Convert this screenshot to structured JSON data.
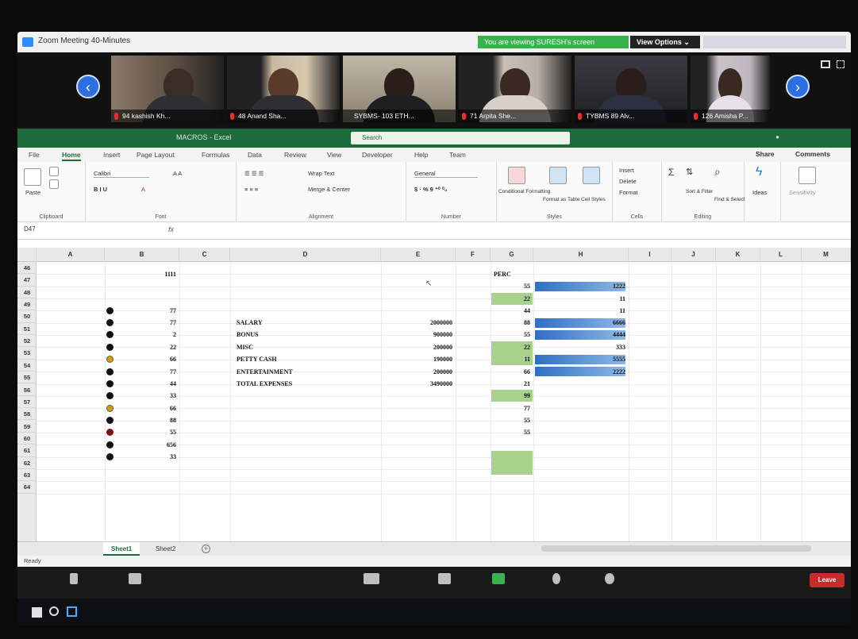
{
  "zoom": {
    "title": "Zoom Meeting 40-Minutes",
    "viewing_banner": "You are viewing SURESH's screen",
    "view_options": "View Options ⌄",
    "participants": [
      {
        "name": "94 kashish Kh..."
      },
      {
        "name": "48 Anand Sha..."
      },
      {
        "name": "SYBMS- 103 ETH..."
      },
      {
        "name": "71 Arpita She..."
      },
      {
        "name": "TYBMS 89 Alv..."
      },
      {
        "name": "126 Amisha P..."
      }
    ],
    "leave_label": "Leave"
  },
  "excel": {
    "title": "MACROS - Excel",
    "search_placeholder": "Search",
    "tabs": [
      "File",
      "Home",
      "Insert",
      "Page Layout",
      "Formulas",
      "Data",
      "Review",
      "View",
      "Developer",
      "Help",
      "Team"
    ],
    "share": "Share",
    "comments": "Comments",
    "ribbon": {
      "paste": "Paste",
      "clipboard": "Clipboard",
      "font_name": "Calibri",
      "font": "Font",
      "wrap_text": "Wrap Text",
      "merge_center": "Merge & Center",
      "alignment": "Alignment",
      "number_format": "General",
      "number": "Number",
      "conditional": "Conditional Formatting",
      "format_table": "Format as Table",
      "cell_styles": "Cell Styles",
      "styles": "Styles",
      "insert": "Insert",
      "delete": "Delete",
      "format": "Format",
      "cells": "Cells",
      "sort_filter": "Sort & Filter",
      "find_select": "Find & Select",
      "editing": "Editing",
      "ideas": "Ideas",
      "sensitivity": "Sensitivity"
    },
    "name_box": "D47",
    "fx": "fx",
    "columns": [
      "A",
      "B",
      "C",
      "D",
      "E",
      "F",
      "G",
      "H",
      "I",
      "J",
      "K",
      "L",
      "M"
    ],
    "rows": [
      "46",
      "47",
      "48",
      "49",
      "50",
      "51",
      "52",
      "53",
      "54",
      "55",
      "56",
      "57",
      "58",
      "59",
      "60",
      "61",
      "62",
      "63",
      "64"
    ],
    "cells": {
      "b46": "1111",
      "g46": "PERC",
      "col_b": [
        "",
        "",
        "77",
        "77",
        "2",
        "22",
        "66",
        "77",
        "44",
        "33",
        "66",
        "88",
        "55",
        "656",
        "33"
      ],
      "col_d": [
        "SALARY",
        "BONUS",
        "MISC",
        "PETTY CASH",
        "ENTERTAINMENT",
        "TOTAL EXPENSES"
      ],
      "col_e": [
        "2000000",
        "900000",
        "200000",
        "190000",
        "200000",
        "3490000"
      ],
      "col_g": [
        "55",
        "22",
        "44",
        "88",
        "55",
        "22",
        "11",
        "66",
        "21",
        "99",
        "77",
        "55",
        "55"
      ],
      "col_h": [
        "1222",
        "11",
        "11",
        "6666",
        "4444",
        "333",
        "5555",
        "2222"
      ]
    },
    "sheet_tabs": [
      "Sheet1",
      "Sheet2"
    ],
    "status": "Ready"
  }
}
